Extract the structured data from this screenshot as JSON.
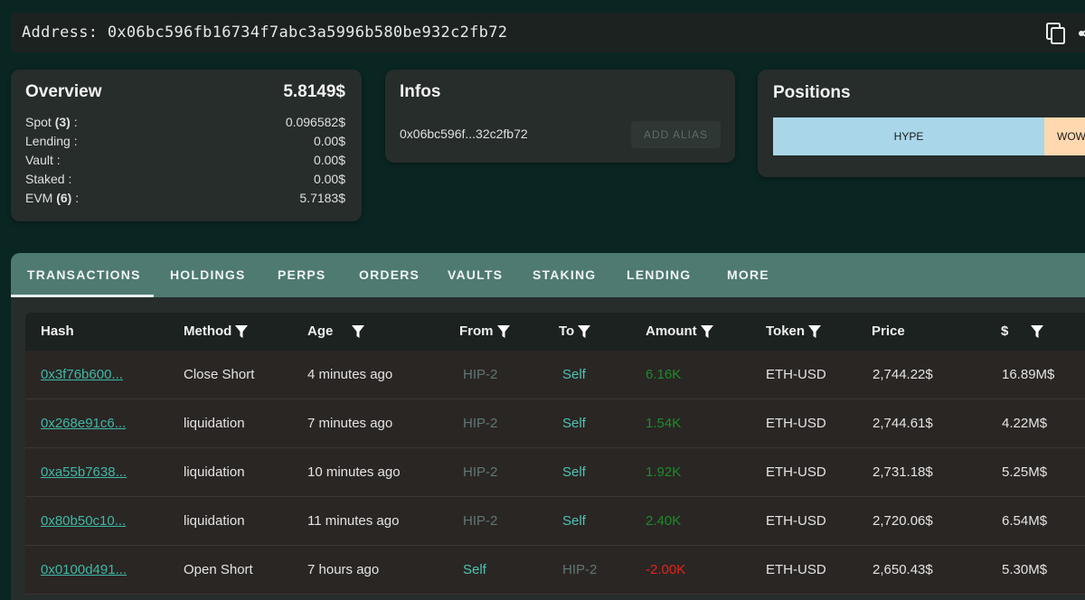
{
  "address_bar": {
    "label": "Address: 0x06bc596fb16734f7abc3a5996b580be932c2fb72",
    "copy_icon": "copy-icon",
    "share_icon": "share-icon"
  },
  "overview": {
    "title": "Overview",
    "total": "5.8149$",
    "rows": [
      {
        "label": "Spot",
        "count": "(3)",
        "suffix": " :",
        "value": "0.096582$"
      },
      {
        "label": "Lending :",
        "count": "",
        "suffix": "",
        "value": "0.00$"
      },
      {
        "label": "Vault :",
        "count": "",
        "suffix": "",
        "value": "0.00$"
      },
      {
        "label": "Staked :",
        "count": "",
        "suffix": "",
        "value": "0.00$"
      },
      {
        "label": "EVM",
        "count": "(6)",
        "suffix": " :",
        "value": "5.7183$"
      }
    ]
  },
  "infos": {
    "title": "Infos",
    "short_address": "0x06bc596f...32c2fb72",
    "add_alias_label": "ADD ALIAS"
  },
  "positions": {
    "title": "Positions",
    "bars": [
      {
        "label": "HYPE",
        "color": "#a9d6e8"
      },
      {
        "label": "WOW",
        "color": "#ffd8b0"
      }
    ]
  },
  "tabs": {
    "active": "TRANSACTIONS",
    "items": [
      "TRANSACTIONS",
      "HOLDINGS",
      "PERPS",
      "ORDERS",
      "VAULTS",
      "STAKING",
      "LENDING",
      "MORE"
    ]
  },
  "table": {
    "headers": {
      "hash": "Hash",
      "method": "Method",
      "age": "Age",
      "from": "From",
      "to": "To",
      "amount": "Amount",
      "token": "Token",
      "price": "Price",
      "usd": "$"
    },
    "rows": [
      {
        "hash": "0x3f76b600...",
        "method": "Close Short",
        "age": "4 minutes ago",
        "from": "HIP-2",
        "to": "Self",
        "amount": "6.16K",
        "amount_sign": "positive",
        "token": "ETH-USD",
        "price": "2,744.22$",
        "usd": "16.89M$"
      },
      {
        "hash": "0x268e91c6...",
        "method": "liquidation",
        "age": "7 minutes ago",
        "from": "HIP-2",
        "to": "Self",
        "amount": "1.54K",
        "amount_sign": "positive",
        "token": "ETH-USD",
        "price": "2,744.61$",
        "usd": "4.22M$"
      },
      {
        "hash": "0xa55b7638...",
        "method": "liquidation",
        "age": "10 minutes ago",
        "from": "HIP-2",
        "to": "Self",
        "amount": "1.92K",
        "amount_sign": "positive",
        "token": "ETH-USD",
        "price": "2,731.18$",
        "usd": "5.25M$"
      },
      {
        "hash": "0x80b50c10...",
        "method": "liquidation",
        "age": "11 minutes ago",
        "from": "HIP-2",
        "to": "Self",
        "amount": "2.40K",
        "amount_sign": "positive",
        "token": "ETH-USD",
        "price": "2,720.06$",
        "usd": "6.54M$"
      },
      {
        "hash": "0x0100d491...",
        "method": "Open Short",
        "age": "7 hours ago",
        "from": "Self",
        "to": "HIP-2",
        "amount": "-2.00K",
        "amount_sign": "negative",
        "token": "ETH-USD",
        "price": "2,650.43$",
        "usd": "5.30M$"
      }
    ]
  },
  "colors": {
    "background": "#0a2622",
    "card": "#262d2b",
    "tabbar": "#4e7a72",
    "link": "#3fb8a5",
    "positive": "#1e8a2a",
    "negative": "#e0241c"
  }
}
